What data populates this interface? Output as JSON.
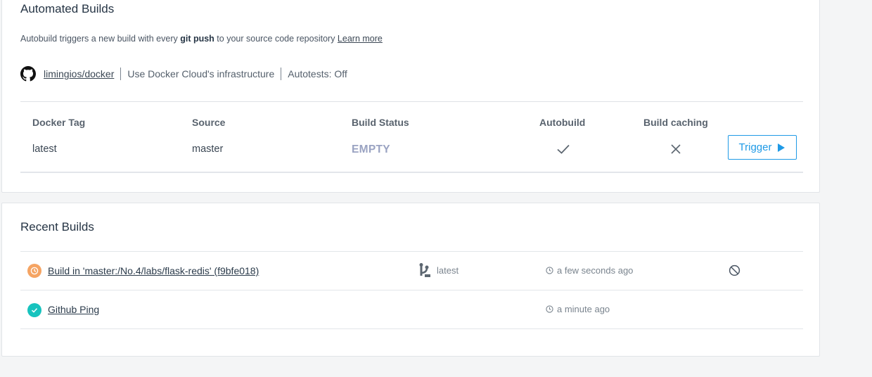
{
  "automated": {
    "title": "Automated Builds",
    "subtitle_prefix": "Autobuild triggers a new build with every ",
    "subtitle_bold": "git push",
    "subtitle_suffix": " to your source code repository ",
    "learn_more": "Learn more",
    "repo_icon": "github-icon",
    "repo_name": "limingios/docker",
    "infrastructure": "Use Docker Cloud's infrastructure",
    "autotests": "Autotests: Off",
    "columns": [
      "Docker Tag",
      "Source",
      "Build Status",
      "Autobuild",
      "Build caching"
    ],
    "rule": {
      "tag": "latest",
      "source": "master",
      "status": "EMPTY",
      "autobuild_icon": "check-icon",
      "caching_icon": "x-icon"
    },
    "trigger_label": "Trigger"
  },
  "recent": {
    "title": "Recent Builds",
    "builds": [
      {
        "name": "Build in 'master:/No.4/labs/flask-redis' (f9bfe018)",
        "status_icon": "in-progress-clock-icon",
        "status_color": "#f5a463",
        "tag": "latest",
        "time": "a few seconds ago",
        "action_icon": "cancel-icon"
      },
      {
        "name": "Github Ping",
        "status_icon": "success-check-icon",
        "status_color": "#17c3be",
        "time": "a minute ago"
      }
    ]
  },
  "colors": {
    "accent": "#1f9ae6",
    "empty_status": "#9aa3c2",
    "in_progress": "#f5a463",
    "success": "#17c3be"
  }
}
